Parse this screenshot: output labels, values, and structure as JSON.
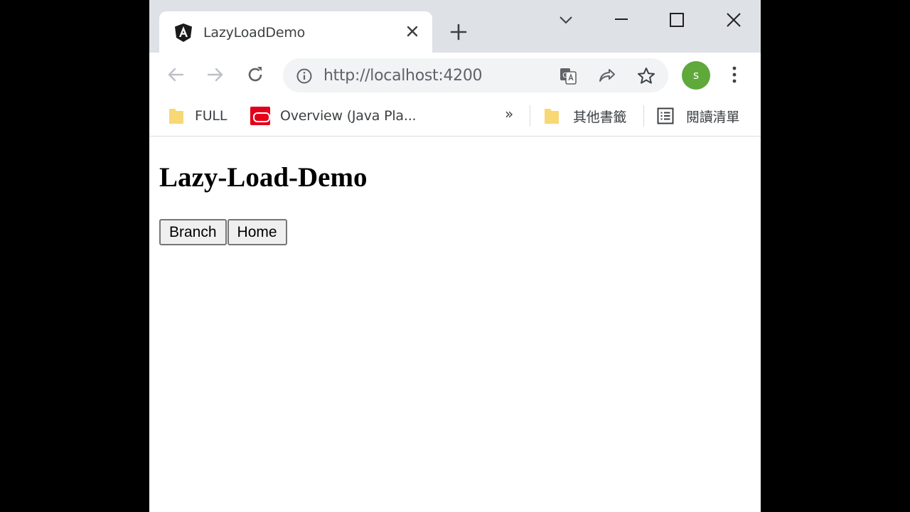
{
  "browser": {
    "tab": {
      "title": "LazyLoadDemo",
      "favicon": "angular-icon"
    },
    "omnibox": {
      "url": "http://localhost:4200"
    },
    "profile": {
      "initial": "s",
      "color": "#5fa83a"
    },
    "bookmarks": [
      {
        "label": "FULL",
        "icon": "folder-icon"
      },
      {
        "label": "Overview (Java Pla...",
        "icon": "oracle-icon"
      }
    ],
    "overflow_label": "»",
    "other_bookmarks": {
      "label": "其他書籤",
      "icon": "folder-icon"
    },
    "reading_list": {
      "label": "閱讀清單",
      "icon": "reading-list-icon"
    }
  },
  "page": {
    "title": "Lazy-Load-Demo",
    "buttons": [
      {
        "label": "Branch"
      },
      {
        "label": "Home"
      }
    ]
  }
}
